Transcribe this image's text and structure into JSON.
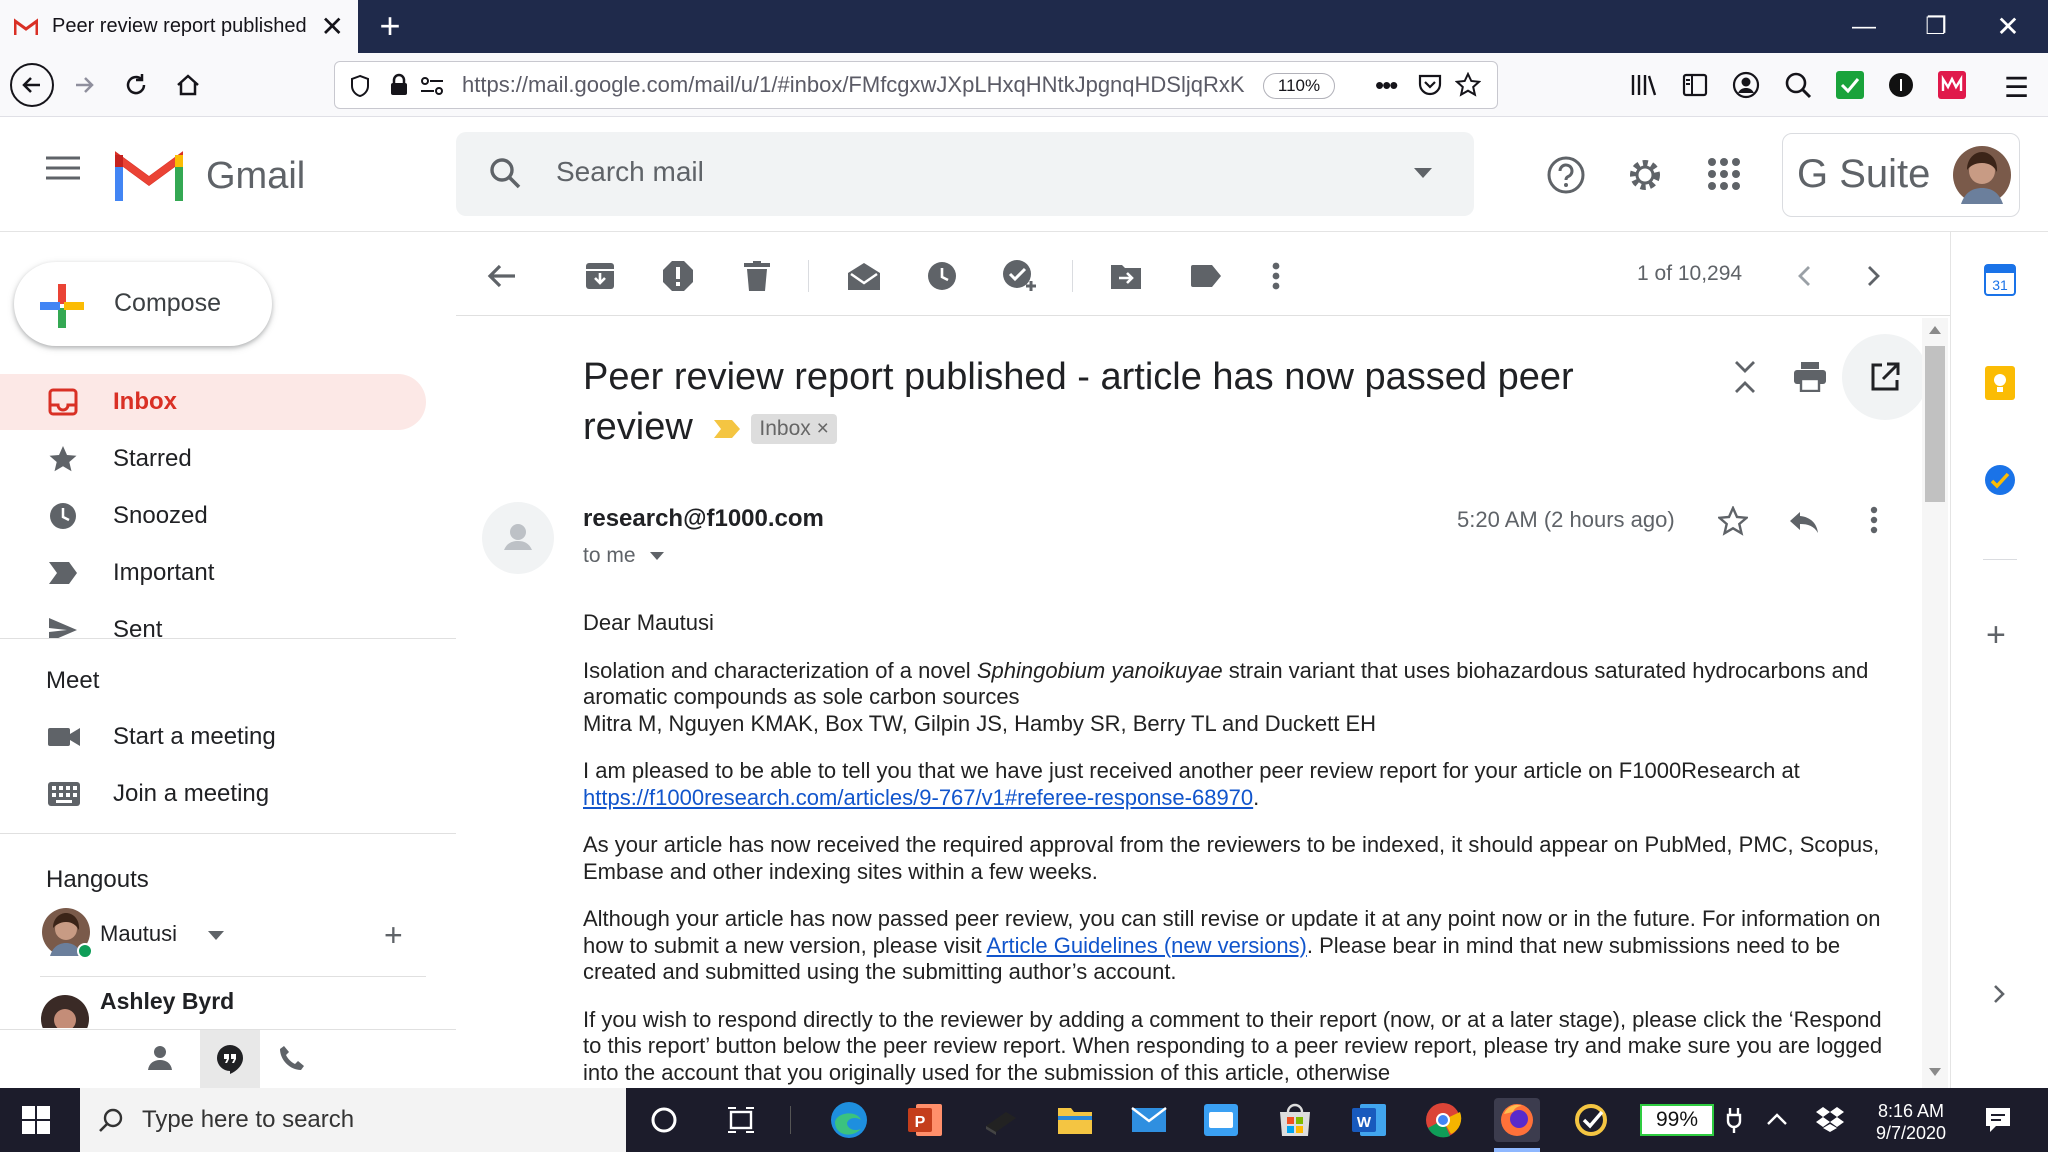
{
  "browser": {
    "tab_title": "Peer review report published -",
    "url_host": "https://mail.google.com",
    "url_path": "/mail/u/1/#inbox/FMfcgxwJXpLHxqHNtkJpgnqHDSljqRxK",
    "zoom": "110%"
  },
  "gmail": {
    "logo_text": "Gmail",
    "search_placeholder": "Search mail",
    "gsuite_label": "G Suite"
  },
  "sidebar": {
    "compose_label": "Compose",
    "items": [
      {
        "label": "Inbox",
        "icon": "inbox-icon",
        "active": true
      },
      {
        "label": "Starred",
        "icon": "star-icon"
      },
      {
        "label": "Snoozed",
        "icon": "clock-icon"
      },
      {
        "label": "Important",
        "icon": "important-icon"
      },
      {
        "label": "Sent",
        "icon": "send-icon"
      }
    ],
    "meet": {
      "heading": "Meet",
      "items": [
        {
          "label": "Start a meeting",
          "icon": "video-icon"
        },
        {
          "label": "Join a meeting",
          "icon": "keyboard-icon"
        }
      ]
    },
    "hangouts": {
      "heading": "Hangouts",
      "self_name": "Mautusi",
      "contact_name": "Ashley Byrd"
    }
  },
  "toolbar": {
    "pagination": "1 of 10,294"
  },
  "email": {
    "subject": "Peer review report published - article has now passed peer review",
    "label_chip": "Inbox",
    "sender": "research@f1000.com",
    "recipient_line": "to me",
    "timestamp": "5:20 AM (2 hours ago)",
    "greeting": "Dear Mautusi",
    "title_before": "Isolation and characterization of a novel ",
    "title_italic": "Sphingobium yanoikuyae",
    "title_after": " strain variant that uses biohazardous saturated hydrocarbons and aromatic compounds as sole carbon sources",
    "authors": "Mitra M, Nguyen KMAK, Box TW, Gilpin JS, Hamby SR, Berry TL and Duckett EH",
    "p1_before": "I am pleased to be able to tell you that we have just received another peer review report for your article on F1000Research at ",
    "p1_link": "https://f1000research.com/articles/9-767/v1#referee-response-68970",
    "p1_after": ".",
    "p2": "As your article has now received the required approval from the reviewers to be indexed, it should appear on PubMed, PMC, Scopus, Embase and other indexing sites within a few weeks.",
    "p3_before": "Although your article has now passed peer review, you can still revise or update it at any point now or in the future. For information on how to submit a new version, please visit ",
    "p3_link": "Article Guidelines (new versions)",
    "p3_after": ". Please bear in mind that new submissions need to be created and submitted using the submitting author’s account.",
    "p4": "If you wish to respond directly to the reviewer by adding a comment to their report (now, or at a later stage), please click the ‘Respond to this report’ button below the peer review report. When responding to a peer review report, please try and make sure you are logged into the account that you originally used for the submission of this article, otherwise"
  },
  "right_panel": {
    "calendar_day": "31"
  },
  "taskbar": {
    "search_placeholder": "Type here to search",
    "battery": "99%",
    "time": "8:16 AM",
    "date": "9/7/2020"
  },
  "colors": {
    "gmail_red": "#d93025",
    "tab_bar": "#1f2a4b",
    "taskbar": "#1c1c2b",
    "link": "#1155cc"
  }
}
